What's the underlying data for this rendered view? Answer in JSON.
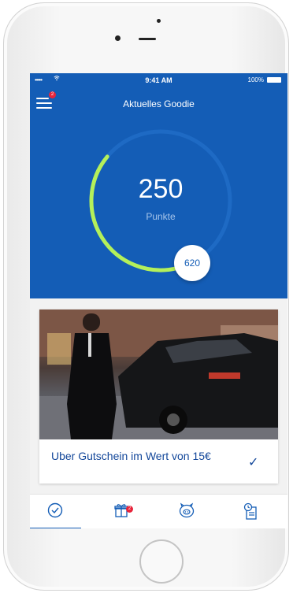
{
  "status_bar": {
    "time": "9:41 AM",
    "battery": "100%",
    "signal": "•••••"
  },
  "header": {
    "title": "Aktuelles Goodie",
    "menu_badge": "2"
  },
  "gauge": {
    "points": "250",
    "points_label": "Punkte",
    "target": "620",
    "progress": 0.4
  },
  "goodie": {
    "text": "Uber Gutschein im Wert von 15€",
    "status_icon": "check-icon"
  },
  "tabs": [
    {
      "icon": "check-circle-icon",
      "active": true
    },
    {
      "icon": "gift-icon",
      "badge": "2"
    },
    {
      "icon": "piggy-bank-icon"
    },
    {
      "icon": "history-document-icon"
    }
  ],
  "colors": {
    "primary": "#145db6",
    "progress": "#b4f05a",
    "badge": "#e8243b",
    "text_accent": "#13479a"
  }
}
